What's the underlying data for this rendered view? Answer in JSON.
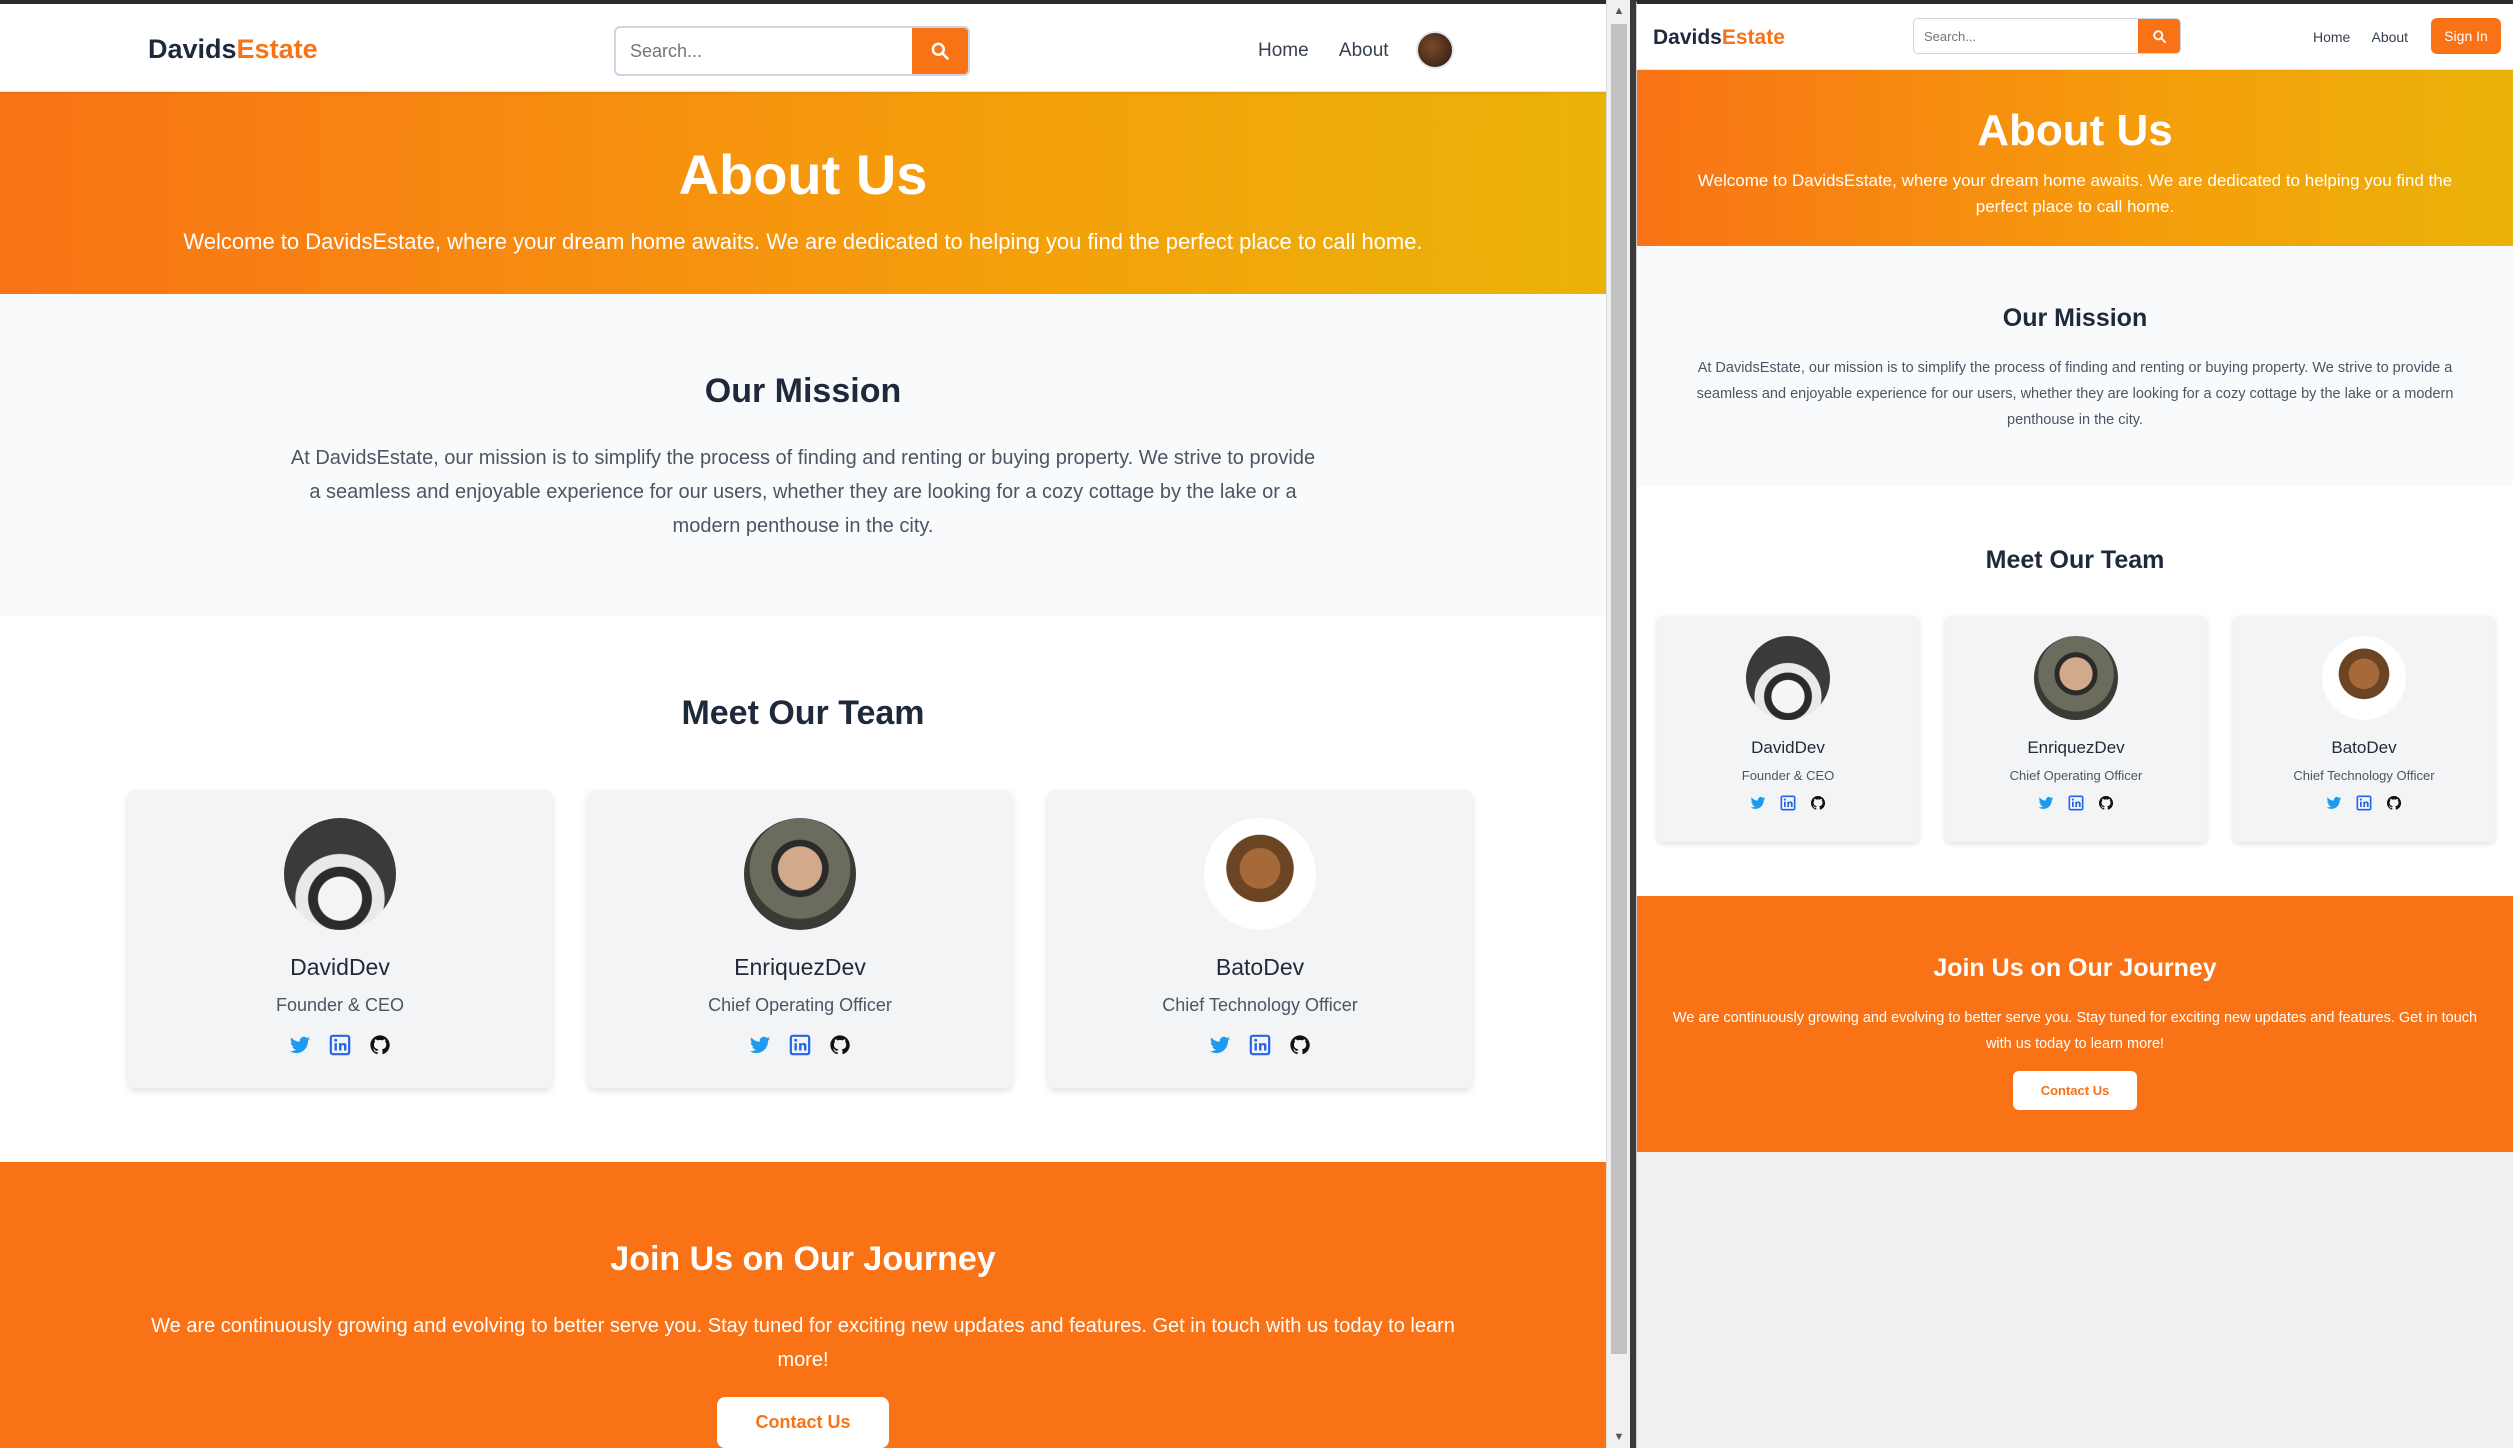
{
  "brand": {
    "name_main": "Davids",
    "name_accent": "Estate",
    "accent_color": "#f97316"
  },
  "nav": {
    "search_placeholder": "Search...",
    "links": [
      "Home",
      "About"
    ],
    "signin_label": "Sign In"
  },
  "hero": {
    "title": "About Us",
    "subtitle": "Welcome to DavidsEstate, where your dream home awaits. We are dedicated to helping you find the perfect place to call home."
  },
  "mission": {
    "title": "Our Mission",
    "body": "At DavidsEstate, our mission is to simplify the process of finding and renting or buying property. We strive to provide a seamless and enjoyable experience for our users, whether they are looking for a cozy cottage by the lake or a modern penthouse in the city."
  },
  "team": {
    "title": "Meet Our Team",
    "members": [
      {
        "name": "DavidDev",
        "role": "Founder & CEO"
      },
      {
        "name": "EnriquezDev",
        "role": "Chief Operating Officer"
      },
      {
        "name": "BatoDev",
        "role": "Chief Technology Officer"
      }
    ],
    "social_icons": [
      "twitter-icon",
      "linkedin-icon",
      "github-icon"
    ]
  },
  "join": {
    "title": "Join Us on Our Journey",
    "body": "We are continuously growing and evolving to better serve you. Stay tuned for exciting new updates and features. Get in touch with us today to learn more!",
    "cta_label": "Contact Us"
  },
  "colors": {
    "hero_gradient_start": "#f97316",
    "hero_gradient_end": "#eab308",
    "join_bg": "#f97316",
    "twitter": "#1d9bf0",
    "linkedin": "#2563eb"
  }
}
